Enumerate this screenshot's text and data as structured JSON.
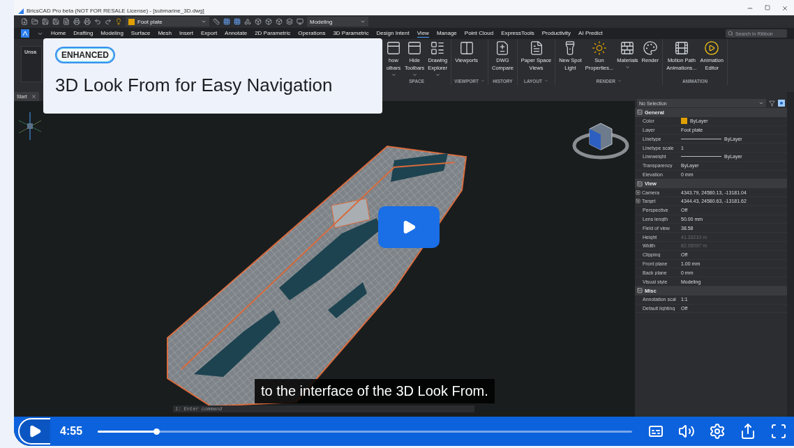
{
  "window": {
    "title": "BricsCAD Pro beta (NOT FOR RESALE License) - [submarine_3D.dwg]"
  },
  "quick_access": {
    "layer": "Foot plate",
    "workspace": "Modeling"
  },
  "ribbon_tabs": [
    {
      "label": "Home",
      "selected": false
    },
    {
      "label": "Drafting",
      "selected": false
    },
    {
      "label": "Modeling",
      "selected": false
    },
    {
      "label": "Surface",
      "selected": false
    },
    {
      "label": "Mesh",
      "selected": false
    },
    {
      "label": "Insert",
      "selected": false
    },
    {
      "label": "Export",
      "selected": false
    },
    {
      "label": "Annotate",
      "selected": false
    },
    {
      "label": "2D Parametric",
      "selected": false
    },
    {
      "label": "Operations",
      "selected": false
    },
    {
      "label": "3D Parametric",
      "selected": false
    },
    {
      "label": "Design Intent",
      "selected": false
    },
    {
      "label": "View",
      "selected": true
    },
    {
      "label": "Manage",
      "selected": false
    },
    {
      "label": "Point Cloud",
      "selected": false
    },
    {
      "label": "ExpressTools",
      "selected": false
    },
    {
      "label": "Productivity",
      "selected": false
    },
    {
      "label": "AI Predict",
      "selected": false
    }
  ],
  "ribbon_search": {
    "placeholder": "Search in Ribbon"
  },
  "ribbon_left": {
    "label": "Unsa"
  },
  "ribbon_groups": [
    {
      "label": "SPACE",
      "menu": false,
      "buttons": [
        {
          "lines": [
            "how",
            "olbars"
          ],
          "menu": true
        },
        {
          "lines": [
            "Hide",
            "Toolbars"
          ],
          "menu": true
        },
        {
          "lines": [
            "Drawing",
            "Explorer"
          ],
          "menu": true
        }
      ]
    },
    {
      "label": "VIEWPORT",
      "menu": true,
      "buttons": [
        {
          "lines": [
            "Viewports"
          ],
          "menu": false
        }
      ]
    },
    {
      "label": "HISTORY",
      "menu": false,
      "buttons": [
        {
          "lines": [
            "DWG",
            "Compare"
          ],
          "menu": false
        }
      ]
    },
    {
      "label": "LAYOUT",
      "menu": true,
      "buttons": [
        {
          "lines": [
            "Paper Space",
            "Views"
          ],
          "menu": false
        }
      ]
    },
    {
      "label": "RENDER",
      "menu": true,
      "buttons": [
        {
          "lines": [
            "New Spot",
            "Light"
          ],
          "menu": false
        },
        {
          "lines": [
            "Sun",
            "Properties..."
          ],
          "menu": false
        },
        {
          "lines": [
            "Materials"
          ],
          "menu": true
        },
        {
          "lines": [
            "Render"
          ],
          "menu": false
        }
      ]
    },
    {
      "label": "ANIMATION",
      "menu": false,
      "buttons": [
        {
          "lines": [
            "Motion Path",
            "Animations..."
          ],
          "menu": false
        },
        {
          "lines": [
            "Animation",
            "Editor"
          ],
          "menu": false
        }
      ]
    }
  ],
  "document_tabs": [
    {
      "label": "Start"
    }
  ],
  "command_line": {
    "placeholder": "1: Enter command"
  },
  "properties": {
    "selection": "No Selection",
    "sections": [
      {
        "label": "General",
        "expanded": true,
        "rows": [
          {
            "label": "Color",
            "value": "ByLayer",
            "kind": "swatch",
            "disabled": false
          },
          {
            "label": "Layer",
            "value": "Foot plate",
            "kind": "text",
            "disabled": false
          },
          {
            "label": "Linetype",
            "value": "ByLayer",
            "kind": "line",
            "disabled": false
          },
          {
            "label": "Linetype scale",
            "value": "1",
            "kind": "text",
            "disabled": false
          },
          {
            "label": "Lineweight",
            "value": "ByLayer",
            "kind": "line",
            "disabled": false
          },
          {
            "label": "Transparency",
            "value": "ByLayer",
            "kind": "text",
            "disabled": false
          },
          {
            "label": "Elevation",
            "value": "0 mm",
            "kind": "text",
            "disabled": false
          }
        ]
      },
      {
        "label": "View",
        "expanded": true,
        "rows": [
          {
            "label": "Camera",
            "value": "4343.79, 24580.13, -13181.04",
            "kind": "expandable",
            "disabled": false
          },
          {
            "label": "Target",
            "value": "4344.43, 24580.63, -13181.62",
            "kind": "expandable",
            "disabled": false
          },
          {
            "label": "Perspective",
            "value": "Off",
            "kind": "text",
            "disabled": false
          },
          {
            "label": "Lens length",
            "value": "50.00 mm",
            "kind": "text",
            "disabled": false
          },
          {
            "label": "Field of view",
            "value": "38.58",
            "kind": "text",
            "disabled": false
          },
          {
            "label": "Height",
            "value": "41.33210 m",
            "kind": "text",
            "disabled": true
          },
          {
            "label": "Width",
            "value": "82.05097 m",
            "kind": "text",
            "disabled": true
          },
          {
            "label": "Clipping",
            "value": "Off",
            "kind": "text",
            "disabled": false
          },
          {
            "label": "Front plane",
            "value": "1.00 mm",
            "kind": "text",
            "disabled": false
          },
          {
            "label": "Back plane",
            "value": "0 mm",
            "kind": "text",
            "disabled": false
          },
          {
            "label": "Visual style",
            "value": "Modeling",
            "kind": "text",
            "disabled": false
          }
        ]
      },
      {
        "label": "Misc",
        "expanded": true,
        "rows": [
          {
            "label": "Annotation scal",
            "value": "1:1",
            "kind": "text",
            "disabled": false
          },
          {
            "label": "Default lighting",
            "value": "Off",
            "kind": "text",
            "disabled": false
          }
        ]
      }
    ]
  },
  "overlay_card": {
    "badge": "ENHANCED",
    "title": "3D Look From for Easy Navigation"
  },
  "subtitle": "to the interface of the 3D Look From.",
  "player": {
    "time": "4:55",
    "progress": {
      "level": 0.11
    }
  }
}
